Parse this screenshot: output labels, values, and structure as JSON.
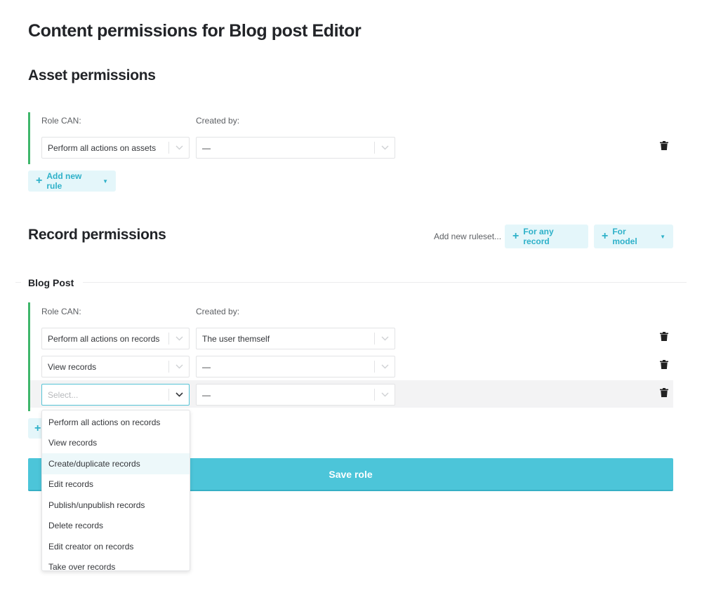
{
  "page": {
    "title": "Content permissions for Blog post Editor"
  },
  "asset_permissions": {
    "heading": "Asset permissions",
    "col_role": "Role CAN:",
    "col_created": "Created by:",
    "rules": [
      {
        "action": "Perform all actions on assets",
        "created_by": "—"
      }
    ],
    "add_rule_label": "Add new rule"
  },
  "record_permissions": {
    "heading": "Record permissions",
    "add_ruleset_label": "Add new ruleset...",
    "for_any_record_label": "For any record",
    "for_model_label": "For model",
    "model_section": {
      "title": "Blog Post",
      "col_role": "Role CAN:",
      "col_created": "Created by:",
      "rules": [
        {
          "action": "Perform all actions on records",
          "created_by": "The user themself"
        },
        {
          "action": "View records",
          "created_by": "—"
        },
        {
          "action_placeholder": "Select...",
          "created_by": "—"
        }
      ]
    }
  },
  "dropdown": {
    "options": [
      "Perform all actions on records",
      "View records",
      "Create/duplicate records",
      "Edit records",
      "Publish/unpublish records",
      "Delete records",
      "Edit creator on records",
      "Take over records"
    ],
    "hovered_index": 2
  },
  "save_label": "Save role",
  "icons": {
    "trash": "trash-icon",
    "plus": "plus-icon",
    "chevron": "chevron-down-icon",
    "caret": "caret-down-icon"
  },
  "colors": {
    "accent": "#4cc5d9",
    "accent_text": "#2eb1c9",
    "accent_light": "#e4f6fa",
    "rule_border": "#3fb66b"
  }
}
